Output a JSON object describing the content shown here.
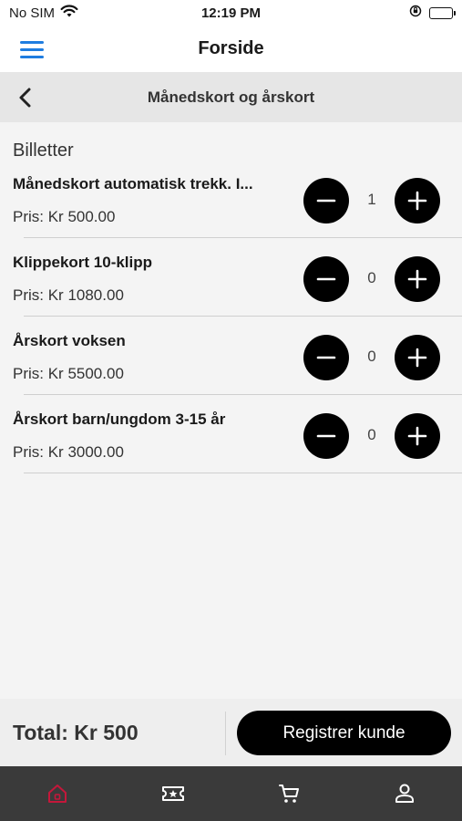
{
  "status_bar": {
    "carrier": "No SIM",
    "time": "12:19 PM"
  },
  "header": {
    "title": "Forside",
    "menu_icon": "hamburger-menu-icon",
    "accent_color": "#1f7de0"
  },
  "subheader": {
    "title": "Månedskort og årskort",
    "back_icon": "chevron-left-icon"
  },
  "section": {
    "title": "Billetter"
  },
  "tickets": [
    {
      "name": "Månedskort automatisk trekk. I...",
      "price": "Pris: Kr 500.00",
      "quantity": "1"
    },
    {
      "name": "Klippekort 10-klipp",
      "price": "Pris: Kr 1080.00",
      "quantity": "0"
    },
    {
      "name": "Årskort voksen",
      "price": "Pris: Kr 5500.00",
      "quantity": "0"
    },
    {
      "name": "Årskort barn/ungdom 3-15 år",
      "price": "Pris: Kr 3000.00",
      "quantity": "0"
    }
  ],
  "footer": {
    "total": "Total: Kr 500",
    "register_label": "Registrer kunde"
  },
  "tabs": [
    {
      "icon": "home-icon",
      "active": true,
      "color": "#c4173a"
    },
    {
      "icon": "ticket-icon",
      "active": false,
      "color": "#ffffff"
    },
    {
      "icon": "cart-icon",
      "active": false,
      "color": "#ffffff"
    },
    {
      "icon": "person-icon",
      "active": false,
      "color": "#ffffff"
    }
  ]
}
